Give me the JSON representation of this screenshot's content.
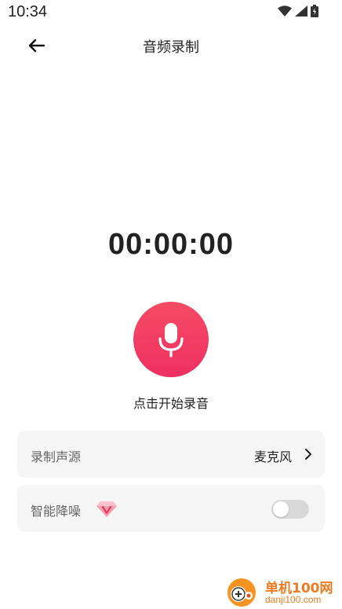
{
  "status_bar": {
    "time": "10:34",
    "icons": [
      "wifi-icon",
      "signal-icon",
      "battery-icon"
    ]
  },
  "header": {
    "title": "音频录制",
    "back_icon": "back-arrow-icon"
  },
  "recorder": {
    "timer": "00:00:00",
    "record_icon": "microphone-icon",
    "hint": "点击开始录音",
    "button_color": "#f2375f"
  },
  "settings": {
    "source": {
      "label": "录制声源",
      "value": "麦克风",
      "icon": "chevron-right-icon"
    },
    "noise_reduction": {
      "label": "智能降噪",
      "badge_icon": "vip-diamond-icon",
      "enabled": false
    }
  },
  "watermark": {
    "title": "单机100网",
    "url": "danji100.com"
  }
}
